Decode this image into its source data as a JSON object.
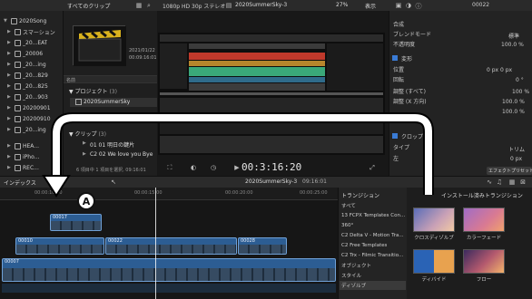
{
  "sidebar": {
    "items": [
      {
        "label": "2020Song",
        "indent": 0
      },
      {
        "label": "スマーション",
        "indent": 1
      },
      {
        "label": "_20...EAT",
        "indent": 1
      },
      {
        "label": "_20006",
        "indent": 1
      },
      {
        "label": "_20...ing",
        "indent": 1
      },
      {
        "label": "_20...829",
        "indent": 1
      },
      {
        "label": "_20...825",
        "indent": 1
      },
      {
        "label": "_20...903",
        "indent": 1
      },
      {
        "label": "20200901",
        "indent": 1
      },
      {
        "label": "20200910",
        "indent": 1
      },
      {
        "label": "_20...ing",
        "indent": 1
      },
      {
        "label": "HEA...",
        "indent": 1
      },
      {
        "label": "iPho...",
        "indent": 1
      },
      {
        "label": "REC...",
        "indent": 1
      }
    ]
  },
  "browser": {
    "filter_label": "すべてのクリップ",
    "clip_date": "2021/01/22",
    "clip_time": "00:09:16:01",
    "header_label": "名前",
    "project_group": "プロジェクト",
    "project_count": "(3)",
    "project_name": "2020SummerSky",
    "clip_group": "クリップ",
    "clip_count": "(3)",
    "clips": [
      "01 01 明日の鍵片",
      "C2 02 We love you Bye"
    ],
    "status": "6 項目中 1 項目を選択, 09:16:01"
  },
  "viewer": {
    "format": "1080p HD 30p ステレオ",
    "project": "2020SummerSky-3",
    "zoom": "27%",
    "view_menu": "表示",
    "timecode": "00:3:16:20"
  },
  "inspector": {
    "timecode": "00022",
    "sections": [
      {
        "label": "合成"
      },
      {
        "label": "ブレンドモード",
        "value": "標準"
      },
      {
        "label": "不透明度",
        "value": "100.0 %"
      },
      {
        "label": "変形",
        "header": true
      },
      {
        "label": "位置",
        "value": "0 px  0 px"
      },
      {
        "label": "回転",
        "value": "0 °"
      },
      {
        "label": "調整 (すべて)",
        "value": "100 %"
      },
      {
        "label": "調整 (X 方向)",
        "value": "100.0 %"
      },
      {
        "label": "",
        "value": "100.0 %"
      },
      {
        "label": "クロップ",
        "header": true
      },
      {
        "label": "タイプ",
        "value": "トリム"
      },
      {
        "label": "左",
        "value": "0 px"
      }
    ],
    "save_label": "エフェクトプリセットを保存"
  },
  "timeline_bar": {
    "index_label": "インデックス",
    "project": "2020SummerSky-3",
    "duration": "09:16:01"
  },
  "ruler": {
    "ticks": [
      "00:00:10:00",
      "00:00:15:00",
      "00:00:20:00",
      "00:00:25:00"
    ]
  },
  "clips": [
    {
      "label": "00017"
    },
    {
      "label": "00010"
    },
    {
      "label": "00022"
    },
    {
      "label": "00028"
    },
    {
      "label": "00007"
    }
  ],
  "transitions": {
    "title": "トランジション",
    "categories": [
      "すべて",
      "13 FCPX Templates Con...",
      "360°",
      "C2 Delta V - Motion Tra...",
      "C2 Free Templates",
      "C2 Trx - Filmic Transitio...",
      "オブジェクト",
      "スタイル",
      "ディゾルブ"
    ],
    "installed_label": "インストール済みトランジション",
    "items": [
      {
        "label": "クロスディゾルブ"
      },
      {
        "label": "カラーフェード"
      },
      {
        "label": "ディバイド"
      },
      {
        "label": "フロー"
      }
    ]
  },
  "annotation": {
    "badge": "A"
  }
}
